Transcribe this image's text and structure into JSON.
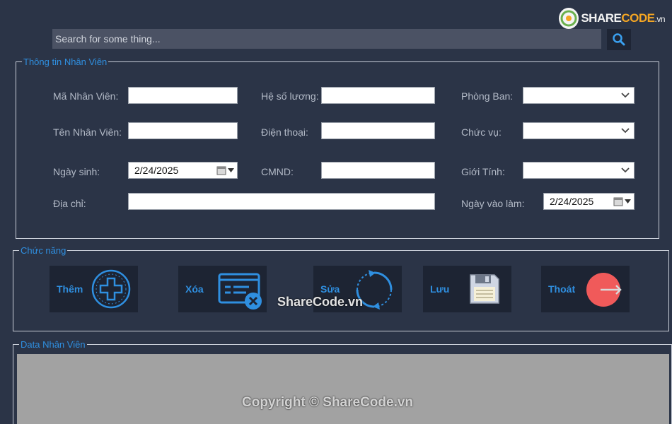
{
  "search": {
    "placeholder": "Search for some thing..."
  },
  "logo": {
    "brand_a": "SHARE",
    "brand_b": "CODE",
    "brand_c": ".vn"
  },
  "info_group": {
    "legend": "Thông tin Nhân Viên",
    "ma_nv_label": "Mã Nhân Viên:",
    "ten_nv_label": "Tên Nhân Viên:",
    "ngay_sinh_label": "Ngày sinh:",
    "ngay_sinh_value": "2/24/2025",
    "dia_chi_label": "Địa chỉ:",
    "he_so_luong_label": "Hệ số lương:",
    "dien_thoai_label": "Điện thoại:",
    "cmnd_label": "CMND:",
    "phong_ban_label": "Phòng Ban:",
    "chuc_vu_label": "Chức vụ:",
    "gioi_tinh_label": "Giới Tính:",
    "ngay_vao_lam_label": "Ngày vào làm:",
    "ngay_vao_lam_value": "2/24/2025"
  },
  "func_group": {
    "legend": "Chức năng",
    "them": "Thêm",
    "xoa": "Xóa",
    "sua": "Sửa",
    "luu": "Lưu",
    "thoat": "Thoát"
  },
  "data_group": {
    "legend": "Data Nhân Viên"
  },
  "watermarks": {
    "center": "ShareCode.vn",
    "bottom": "Copyright © ShareCode.vn"
  },
  "colors": {
    "background": "#2b3447",
    "accent": "#2f8fe0",
    "button_bg": "#1d2433",
    "exit_red": "#f05a5a"
  }
}
